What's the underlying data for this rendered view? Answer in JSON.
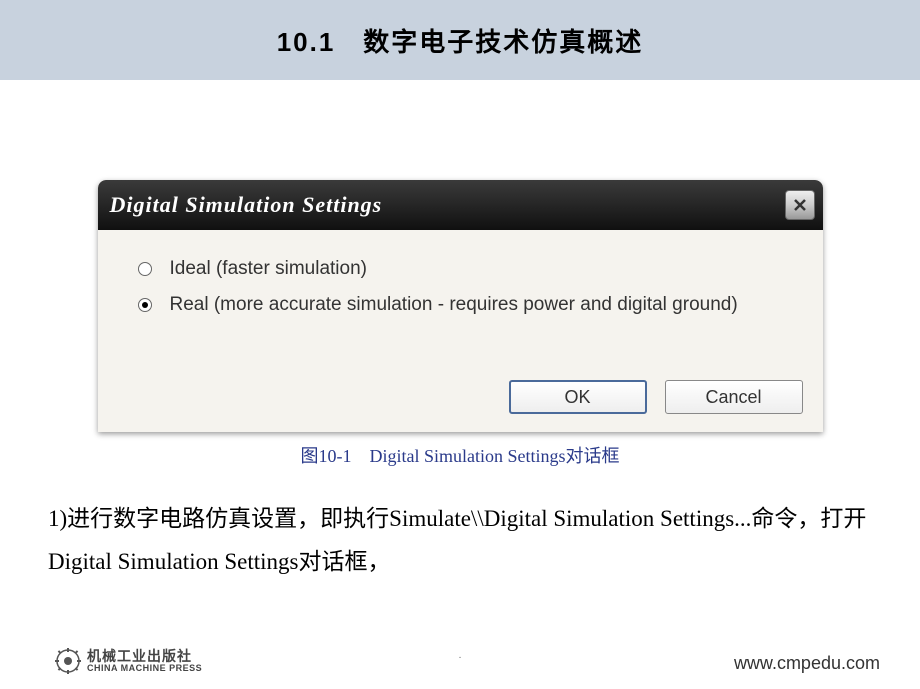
{
  "header": {
    "title": "10.1　数字电子技术仿真概述"
  },
  "dialog": {
    "title": "Digital Simulation Settings",
    "options": {
      "ideal": {
        "label": "Ideal (faster simulation)",
        "selected": false
      },
      "real": {
        "label": "Real (more accurate simulation - requires power and digital ground)",
        "selected": true
      }
    },
    "buttons": {
      "ok": "OK",
      "cancel": "Cancel"
    }
  },
  "figure": {
    "caption": "图10-1　Digital Simulation Settings对话框"
  },
  "body": {
    "paragraph": "1)进行数字电路仿真设置，即执行Simulate\\\\Digital Simulation Settings...命令，打开Digital Simulation Settings对话框，"
  },
  "footer": {
    "publisher_cn": "机械工业出版社",
    "publisher_en": "CHINA MACHINE PRESS",
    "url": "www.cmpedu.com",
    "center": "."
  }
}
